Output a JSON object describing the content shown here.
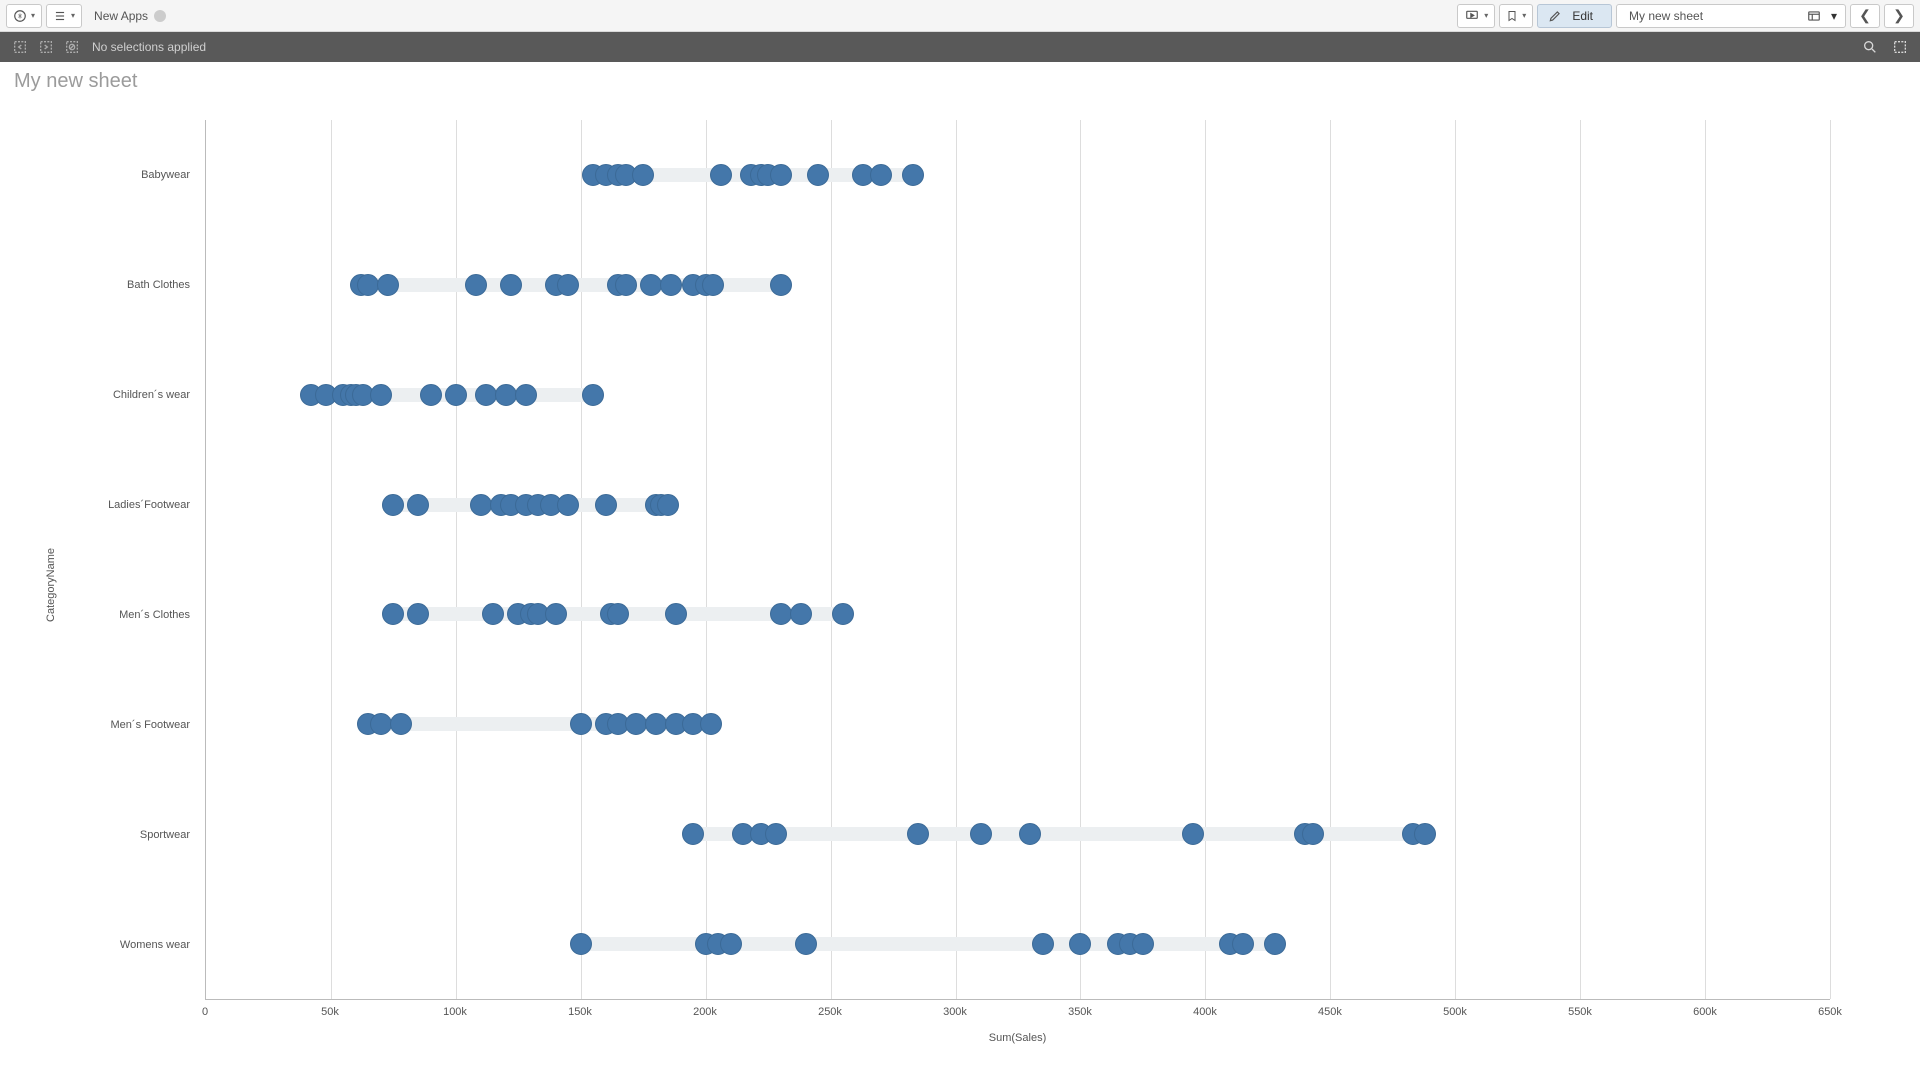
{
  "toolbar": {
    "app_name": "New Apps",
    "edit_label": "Edit",
    "sheet_name": "My new sheet"
  },
  "selection_bar": {
    "text": "No selections applied"
  },
  "sheet": {
    "title": "My new sheet"
  },
  "chart_data": {
    "type": "scatter",
    "title": "",
    "xlabel": "Sum(Sales)",
    "ylabel": "CategoryName",
    "x_ticks": [
      0,
      50000,
      100000,
      150000,
      200000,
      250000,
      300000,
      350000,
      400000,
      450000,
      500000,
      550000,
      600000,
      650000
    ],
    "x_tick_labels": [
      "0",
      "50k",
      "100k",
      "150k",
      "200k",
      "250k",
      "300k",
      "350k",
      "400k",
      "450k",
      "500k",
      "550k",
      "600k",
      "650k"
    ],
    "xlim": [
      0,
      650000
    ],
    "categories": [
      "Babywear",
      "Bath Clothes",
      "Children´s wear",
      "Ladies´Footwear",
      "Men´s Clothes",
      "Men´s Footwear",
      "Sportwear",
      "Womens wear"
    ],
    "series": [
      {
        "name": "Babywear",
        "values": [
          155000,
          160000,
          165000,
          168000,
          175000,
          206000,
          218000,
          222000,
          225000,
          230000,
          245000,
          263000,
          270000,
          283000
        ]
      },
      {
        "name": "Bath Clothes",
        "values": [
          62000,
          65000,
          73000,
          108000,
          122000,
          140000,
          145000,
          165000,
          168000,
          178000,
          186000,
          195000,
          200000,
          203000,
          230000
        ]
      },
      {
        "name": "Children´s wear",
        "values": [
          42000,
          48000,
          55000,
          58000,
          60000,
          63000,
          70000,
          90000,
          100000,
          112000,
          120000,
          128000,
          155000
        ]
      },
      {
        "name": "Ladies´Footwear",
        "values": [
          75000,
          85000,
          110000,
          118000,
          122000,
          128000,
          133000,
          138000,
          145000,
          160000,
          180000,
          182000,
          185000
        ]
      },
      {
        "name": "Men´s Clothes",
        "values": [
          75000,
          85000,
          115000,
          125000,
          130000,
          133000,
          140000,
          162000,
          165000,
          188000,
          230000,
          238000,
          255000
        ]
      },
      {
        "name": "Men´s Footwear",
        "values": [
          65000,
          70000,
          78000,
          150000,
          160000,
          165000,
          172000,
          180000,
          188000,
          195000,
          202000
        ]
      },
      {
        "name": "Sportwear",
        "values": [
          195000,
          215000,
          222000,
          228000,
          285000,
          310000,
          330000,
          395000,
          440000,
          443000,
          483000,
          488000
        ]
      },
      {
        "name": "Womens wear",
        "values": [
          150000,
          200000,
          205000,
          210000,
          240000,
          335000,
          350000,
          365000,
          370000,
          375000,
          410000,
          415000,
          428000
        ]
      }
    ]
  },
  "colors": {
    "dot": "#4477aa"
  }
}
